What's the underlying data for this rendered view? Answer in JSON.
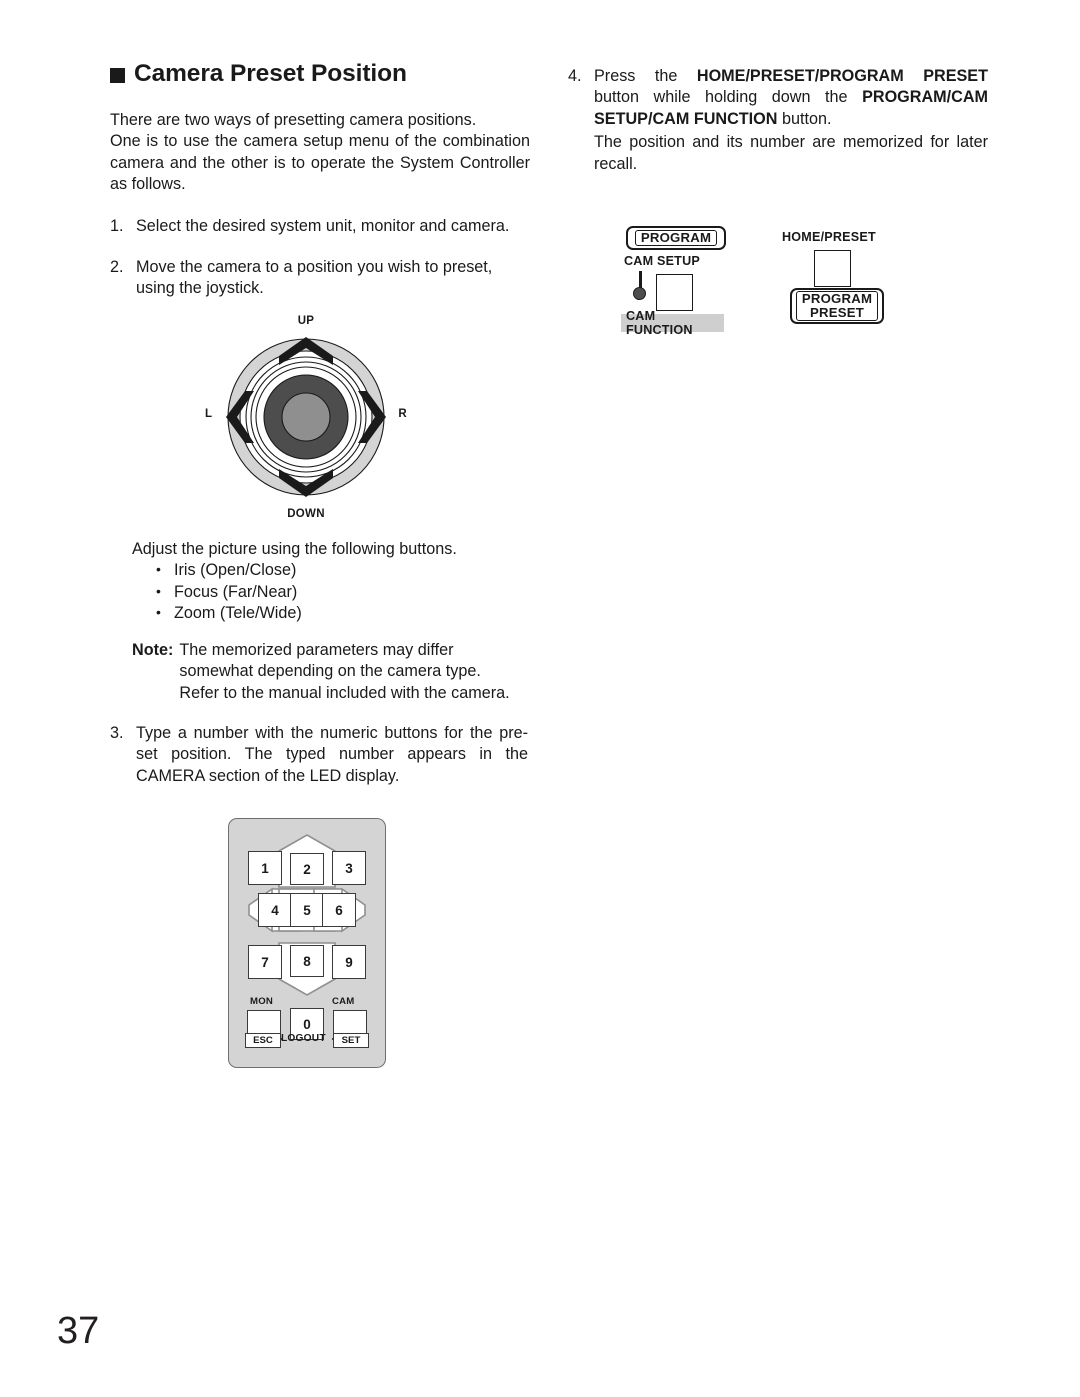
{
  "page": {
    "number": "37"
  },
  "left_column": {
    "heading": "Camera Preset Position",
    "intro_line1": "There are two ways of presetting camera positions.",
    "intro_line2": "One is to use the camera setup menu of the combination camera and the other is to operate the System Controller as follows.",
    "step1": {
      "num": "1.",
      "text": "Select the desired system unit, monitor and camera."
    },
    "step2": {
      "num": "2.",
      "text": "Move the camera to a position you wish to preset, using the joystick."
    },
    "adjust_intro": "Adjust the picture using the following buttons.",
    "adjust_bullets": [
      "Iris (Open/Close)",
      "Focus (Far/Near)",
      "Zoom (Tele/Wide)"
    ],
    "note": {
      "label": "Note:",
      "text": "The memorized parameters may differ somewhat depending on the camera type. Refer to the manual included with the camera."
    },
    "step3": {
      "num": "3.",
      "text": "Type a number with the numeric buttons for the pre-set position. The typed number appears in the CAMERA section of the LED display."
    }
  },
  "right_column": {
    "step4": {
      "num": "4.",
      "part1": "Press the ",
      "bold1": "HOME/PRESET/PROGRAM PRESET",
      "part2": " button while holding down the ",
      "bold2": "PROGRAM/CAM SETUP/CAM FUNCTION",
      "part3": " button.",
      "followup": "The position and its number are memorized for later recall."
    }
  },
  "joystick": {
    "up_label": "UP",
    "down_label": "DOWN",
    "left_label": "L",
    "right_label": "R",
    "colors": {
      "outer_ring": "#d4d4d4",
      "mid_ring": "#ffffff",
      "inner_dark": "#4d4d4d",
      "center_cap": "#8f8f8f",
      "arrow": "#1a1a1a"
    }
  },
  "keypad": {
    "keys": [
      "1",
      "2",
      "3",
      "4",
      "5",
      "6",
      "7",
      "8",
      "9",
      "0"
    ],
    "mon_label": "MON",
    "cam_label": "CAM",
    "esc_label": "ESC",
    "set_label": "SET",
    "logout_label": "LOGOUT",
    "panel_color": "#d4d4d4"
  },
  "button_diagram": {
    "program_label": "PROGRAM",
    "cam_setup_label": "CAM SETUP",
    "cam_function_label": "CAM FUNCTION",
    "home_preset_label": "HOME/PRESET",
    "program_preset_line1": "PROGRAM",
    "program_preset_line2": "PRESET",
    "shaded_color": "#cfcfcf"
  }
}
